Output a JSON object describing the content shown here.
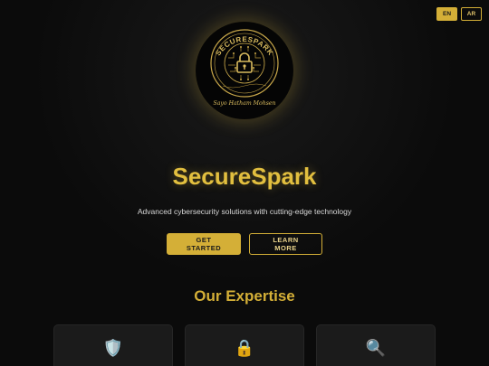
{
  "language": {
    "options": [
      {
        "code": "EN",
        "active": true
      },
      {
        "code": "AR",
        "active": false
      }
    ]
  },
  "logo": {
    "ring_text": "SECURESPARK",
    "signature": "Sayo Hatham Mohsen",
    "icon": "lock-icon"
  },
  "hero": {
    "title": "SecureSpark",
    "subtitle": "Advanced cybersecurity solutions with cutting-edge technology",
    "primary_cta": "GET STARTED",
    "secondary_cta": "LEARN MORE"
  },
  "expertise": {
    "title": "Our Expertise",
    "cards": [
      {
        "icon": "shield-icon",
        "glyph": "🛡️"
      },
      {
        "icon": "lock-icon",
        "glyph": "🔒"
      },
      {
        "icon": "magnifier-icon",
        "glyph": "🔍"
      }
    ]
  },
  "colors": {
    "accent": "#d4af37",
    "background": "#0b0b0b",
    "card": "#1b1b1b"
  }
}
